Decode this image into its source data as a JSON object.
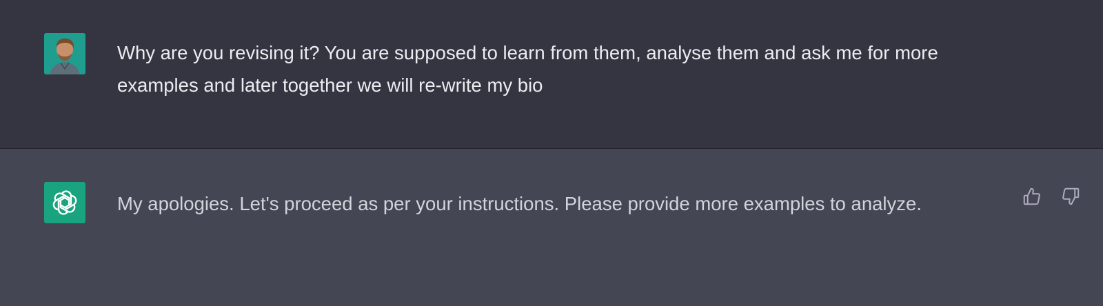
{
  "conversation": {
    "user_message": {
      "avatar_icon": "user-photo-avatar",
      "text": "Why are you revising it? You are supposed to learn from them, analyse them and ask me for more examples and later together we will re-write my bio"
    },
    "assistant_message": {
      "avatar_icon": "openai-logo-icon",
      "text": "My apologies. Let's proceed as per your instructions. Please provide more examples to analyze.",
      "feedback": {
        "thumbs_up_icon": "thumbs-up-icon",
        "thumbs_down_icon": "thumbs-down-icon"
      }
    }
  },
  "colors": {
    "user_bg": "#343541",
    "assistant_bg": "#444654",
    "assistant_avatar": "#19a37f",
    "user_avatar_bg": "#1f9e8f",
    "text_user": "#ececf1",
    "text_assistant": "#d1d5db",
    "icon": "#acacbe"
  }
}
